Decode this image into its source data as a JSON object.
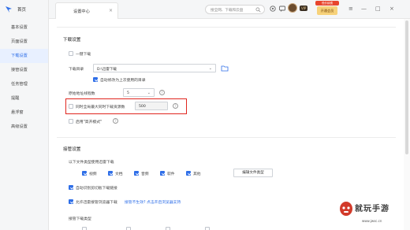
{
  "sidebar": {
    "home_label": "首页",
    "items": [
      {
        "label": "基本设置",
        "active": false
      },
      {
        "label": "页面设置",
        "active": false
      },
      {
        "label": "下载设置",
        "active": true
      },
      {
        "label": "接管设置",
        "active": false
      },
      {
        "label": "任务管理",
        "active": false
      },
      {
        "label": "提醒",
        "active": false
      },
      {
        "label": "悬浮窗",
        "active": false
      },
      {
        "label": "高级设置",
        "active": false
      }
    ]
  },
  "topbar": {
    "tab_label": "设置中心",
    "tab_close": "×",
    "search_placeholder": "搜全网、下载和云盘",
    "vip_badge": "VIP",
    "promo_tag": "低价续费",
    "promo_button": "开通会员",
    "minimize": "—",
    "maximize": "□",
    "close": "×"
  },
  "download_settings": {
    "title": "下载设置",
    "one_click_download": {
      "label": "一键下载",
      "checked": false
    },
    "download_dir_label": "下载目录",
    "download_dir_value": "D:\\迅雷下载",
    "auto_modify_dir": {
      "label": "自动修改为上次使用的目录",
      "checked": true
    },
    "origin_threads_label": "原始地址线程数",
    "origin_threads_value": "5",
    "limit_max_tasks": {
      "label": "同时全局最大同时下载资源数",
      "checked": false,
      "value": "500"
    },
    "open_mode": {
      "label": "启用\"高开模式\"",
      "checked": false
    }
  },
  "takeover_settings": {
    "title": "接管设置",
    "file_types_label": "以下文件类型使用迅雷下载",
    "file_types": [
      {
        "label": "视频",
        "checked": true
      },
      {
        "label": "文档",
        "checked": true
      },
      {
        "label": "音频",
        "checked": true
      },
      {
        "label": "软件",
        "checked": true
      },
      {
        "label": "其他",
        "checked": true
      }
    ],
    "edit_types_button": "编辑文件类型",
    "auto_detect": {
      "label": "自动识别剪切板下载链接",
      "checked": true
    },
    "allow_browser": {
      "label": "允许迅雷接管浏览器下载",
      "checked": true
    },
    "browser_link_text": "接管不生效? 点击开启浏览器支持",
    "takeover_list_label": "接管下载类型"
  },
  "watermark": {
    "text": "就玩手游",
    "url": "www.jwsc.cn"
  },
  "colors": {
    "accent": "#2f6fe8",
    "highlight": "#e0261f",
    "sidebar_bg": "#f5f6f7"
  }
}
